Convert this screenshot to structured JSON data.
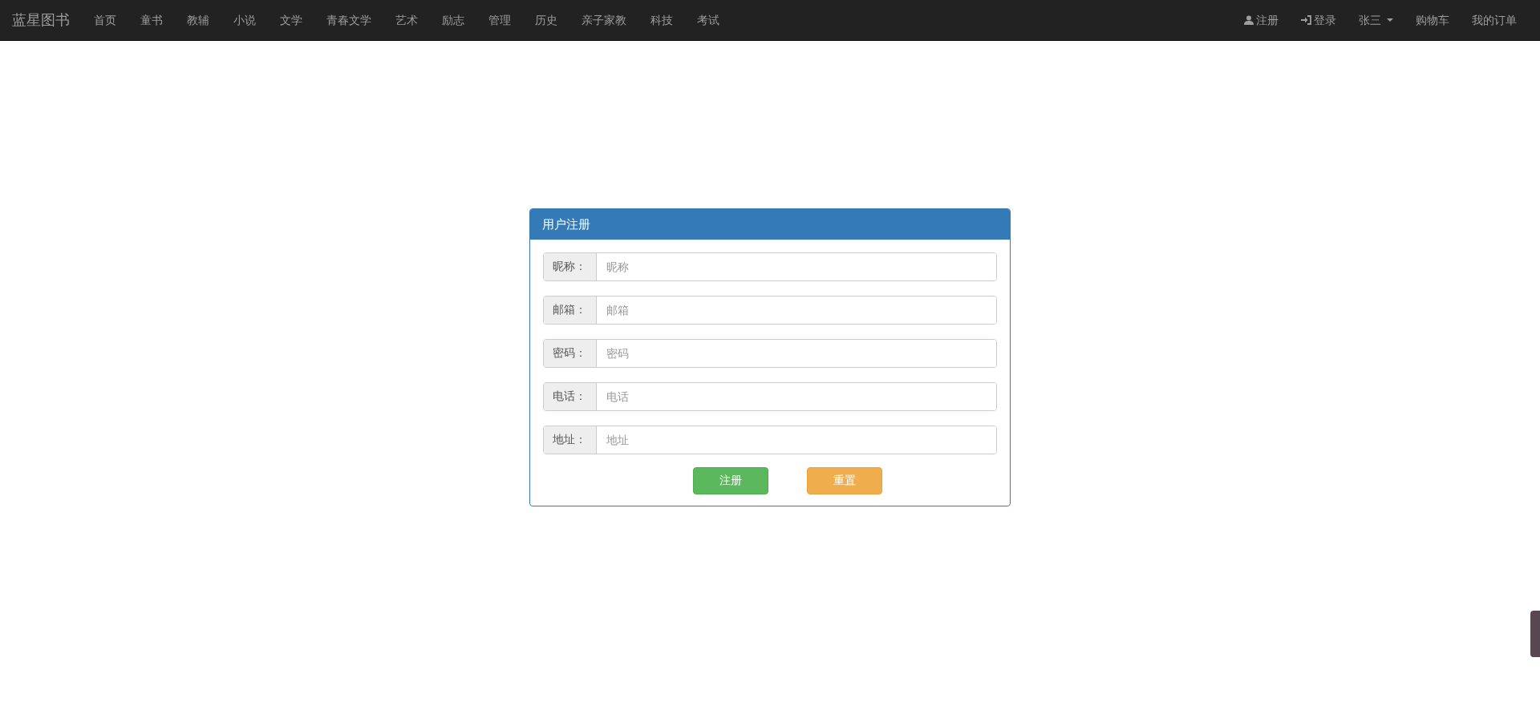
{
  "navbar": {
    "brand": "蓝星图书",
    "categories": [
      "首页",
      "童书",
      "教辅",
      "小说",
      "文学",
      "青春文学",
      "艺术",
      "励志",
      "管理",
      "历史",
      "亲子家教",
      "科技",
      "考试"
    ],
    "user_links": [
      {
        "label": "注册",
        "kind": "register"
      },
      {
        "label": "登录",
        "kind": "login"
      },
      {
        "label": "张三",
        "kind": "dropdown"
      },
      {
        "label": "购物车",
        "kind": "plain"
      },
      {
        "label": "我的订单",
        "kind": "plain"
      }
    ]
  },
  "panel": {
    "title": "用户注册",
    "fields": [
      {
        "label": "昵称：",
        "placeholder": "昵称"
      },
      {
        "label": "邮箱：",
        "placeholder": "邮箱"
      },
      {
        "label": "密码：",
        "placeholder": "密码"
      },
      {
        "label": "电话：",
        "placeholder": "电话"
      },
      {
        "label": "地址：",
        "placeholder": "地址"
      }
    ],
    "buttons": [
      {
        "label": "注册",
        "kind": "primary"
      },
      {
        "label": "重置",
        "kind": "reset"
      }
    ]
  }
}
